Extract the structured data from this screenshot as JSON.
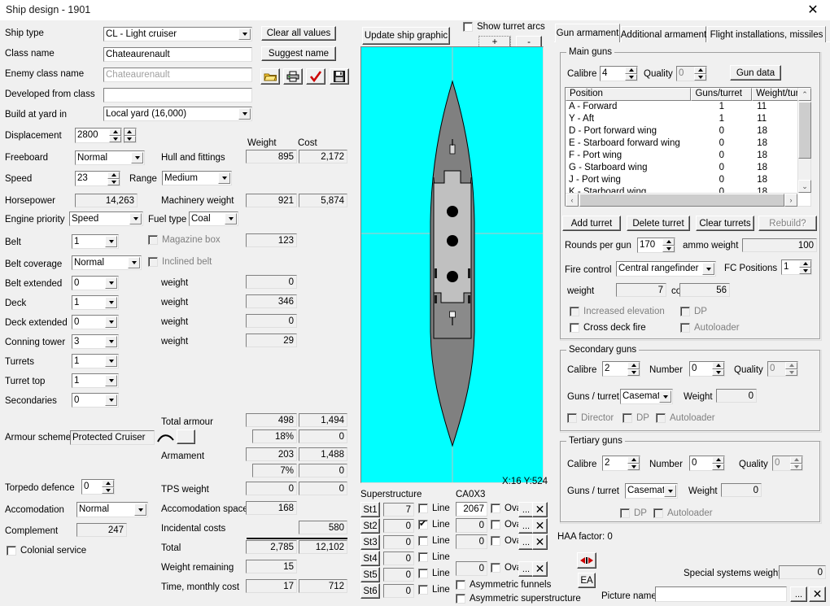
{
  "window": {
    "title": "Ship design - 1901",
    "close_icon": "close-icon"
  },
  "left_panel": {
    "fields": [
      {
        "label": "Ship type",
        "value": "CL - Light cruiser"
      },
      {
        "label": "Class name",
        "value": "Chateaurenault"
      },
      {
        "label": "Enemy class name",
        "value": "Chateaurenault"
      },
      {
        "label": "Developed from class",
        "value": ""
      },
      {
        "label": "Build at yard in",
        "value": "Local yard (16,000)"
      },
      {
        "label": "Displacement",
        "value": "2800"
      },
      {
        "label": "Freeboard",
        "value": "Normal"
      },
      {
        "label": "Speed",
        "value": "23"
      },
      {
        "label": "Range",
        "value": "Medium"
      },
      {
        "label": "Horsepower",
        "value": "14,263"
      },
      {
        "label": "Engine priority",
        "value": "Speed"
      },
      {
        "label": "Fuel type",
        "value": "Coal"
      },
      {
        "label": "Belt",
        "value": "1"
      },
      {
        "label": "Belt coverage",
        "value": "Normal"
      },
      {
        "label": "Belt extended",
        "value": "0"
      },
      {
        "label": "Deck",
        "value": "1"
      },
      {
        "label": "Deck extended",
        "value": "0"
      },
      {
        "label": "Conning tower",
        "value": "3"
      },
      {
        "label": "Turrets",
        "value": "1"
      },
      {
        "label": "Turret top",
        "value": "1"
      },
      {
        "label": "Secondaries",
        "value": "0"
      },
      {
        "label": "Armour scheme",
        "value": "Protected Cruiser"
      },
      {
        "label": "Torpedo defence",
        "value": "0"
      },
      {
        "label": "Accomodation",
        "value": "Normal"
      },
      {
        "label": "Complement",
        "value": "247"
      }
    ],
    "checkboxes": {
      "magazine_box": "Magazine box",
      "inclined_belt": "Inclined belt",
      "colonial_service": "Colonial service"
    },
    "weight_labels": {
      "hull_and_fittings": "Hull and fittings",
      "machinery_weight": "Machinery weight",
      "weight_1": "weight",
      "weight_2": "weight",
      "weight_3": "weight",
      "weight_4": "weight",
      "total_armour": "Total armour",
      "armament": "Armament",
      "tps_weight": "TPS weight",
      "accomodation_space": "Accomodation space",
      "incidental_costs": "Incidental costs",
      "total": "Total",
      "weight_remaining": "Weight remaining",
      "time_monthly_cost": "Time, monthly cost"
    },
    "columns": {
      "weight": "Weight",
      "cost": "Cost"
    },
    "values": {
      "hull_weight": "895",
      "hull_cost": "2,172",
      "machinery_weight": "921",
      "machinery_cost": "5,874",
      "belt_weight": "123",
      "w1": "0",
      "w2": "346",
      "w3": "0",
      "w4": "29",
      "total_armour_weight": "498",
      "total_armour_cost": "1,494",
      "armour_pct": "18%",
      "armour_pct_cost": "0",
      "armament_weight": "203",
      "armament_cost": "1,488",
      "armament_pct": "7%",
      "armament_pct_cost": "0",
      "tps_weight": "0",
      "tps_cost": "0",
      "accomodation_space": "168",
      "incidental_costs": "580",
      "total_weight": "2,785",
      "total_cost": "12,102",
      "weight_remaining": "15",
      "time": "17",
      "monthly_cost": "712"
    }
  },
  "toolbar": {
    "clear_all_values": "Clear all values",
    "suggest_name": "Suggest name",
    "open_icon": "open-folder-icon",
    "print_icon": "printer-icon",
    "check_icon": "check-mark-icon",
    "save_icon": "floppy-save-icon",
    "update_ship_graphic": "Update ship graphic",
    "show_turret_arcs": "Show turret arcs",
    "zoom_in": "+",
    "zoom_out": "-"
  },
  "ship_graphic": {
    "coordinates": "X:16 Y:524",
    "sea_color": "#00ffff",
    "hull_color": "#808080",
    "superstructure_color": "#c0c0c0"
  },
  "superstructure": {
    "title": "Superstructure",
    "funnel_title": "CA0X3",
    "rows": [
      {
        "name": "St1",
        "value": "7",
        "line": "Line",
        "line_checked": false
      },
      {
        "name": "St2",
        "value": "0",
        "line": "Line",
        "line_checked": true
      },
      {
        "name": "St3",
        "value": "0",
        "line": "Line",
        "line_checked": false
      },
      {
        "name": "St4",
        "value": "0",
        "line": "Line",
        "line_checked": false
      },
      {
        "name": "St5",
        "value": "0",
        "line": "Line",
        "line_checked": false
      },
      {
        "name": "St6",
        "value": "0",
        "line": "Line",
        "line_checked": false
      }
    ],
    "funnels": [
      {
        "value": "2067",
        "oval": "Oval",
        "oval_checked": false,
        "browse": "...",
        "clear": "✕"
      },
      {
        "value": "0",
        "oval": "Oval",
        "oval_checked": false,
        "browse": "...",
        "clear": "✕"
      },
      {
        "value": "0",
        "oval": "Oval",
        "oval_checked": false,
        "browse": "...",
        "clear": "✕"
      },
      {
        "value": "0",
        "oval": "Oval",
        "oval_checked": false,
        "browse": "...",
        "clear": "✕"
      }
    ],
    "asymmetric_funnels": "Asymmetric funnels",
    "asymmetric_superstructure": "Asymmetric superstructure"
  },
  "right_panel": {
    "tabs": [
      {
        "label": "Gun armament",
        "active": true
      },
      {
        "label": "Additional armament",
        "active": false
      },
      {
        "label": "Flight installations, missiles",
        "active": false
      }
    ],
    "main_guns": {
      "title": "Main guns",
      "calibre_label": "Calibre",
      "calibre": "4",
      "quality_label": "Quality",
      "quality": "0",
      "gun_data_button": "Gun data",
      "columns": [
        "Position",
        "Guns/turret",
        "Weight/turret"
      ],
      "rows": [
        {
          "position": "A - Forward",
          "guns": "1",
          "weight": "11"
        },
        {
          "position": "Y - Aft",
          "guns": "1",
          "weight": "11"
        },
        {
          "position": "D - Port forward wing",
          "guns": "0",
          "weight": "18"
        },
        {
          "position": "E - Starboard forward wing",
          "guns": "0",
          "weight": "18"
        },
        {
          "position": "F - Port wing",
          "guns": "0",
          "weight": "18"
        },
        {
          "position": "G - Starboard wing",
          "guns": "0",
          "weight": "18"
        },
        {
          "position": "J - Port wing",
          "guns": "0",
          "weight": "18"
        },
        {
          "position": "K - Starboard wing",
          "guns": "0",
          "weight": "18"
        }
      ],
      "add_turret": "Add turret",
      "delete_turret": "Delete turret",
      "clear_turrets": "Clear turrets",
      "rebuild": "Rebuild?",
      "rounds_per_gun_label": "Rounds per gun",
      "rounds_per_gun": "170",
      "ammo_weight_label": "ammo weight",
      "ammo_weight": "100",
      "fire_control_label": "Fire control",
      "fire_control": "Central rangefinder",
      "fc_positions_label": "FC Positions",
      "fc_positions": "1",
      "weight_label": "weight",
      "weight": "7",
      "cost_label": "cost",
      "cost": "56",
      "increased_elevation": "Increased elevation",
      "dp": "DP",
      "cross_deck_fire": "Cross deck fire",
      "autoloader": "Autoloader"
    },
    "secondary_guns": {
      "title": "Secondary guns",
      "calibre_label": "Calibre",
      "calibre": "2",
      "number_label": "Number",
      "number": "0",
      "quality_label": "Quality",
      "quality": "0",
      "guns_per_turret_label": "Guns / turret",
      "guns_per_turret": "Casemate:",
      "weight_label": "Weight",
      "weight": "0",
      "director": "Director",
      "dp": "DP",
      "autoloader": "Autoloader"
    },
    "tertiary_guns": {
      "title": "Tertiary guns",
      "calibre_label": "Calibre",
      "calibre": "2",
      "number_label": "Number",
      "number": "0",
      "quality_label": "Quality",
      "quality": "0",
      "guns_per_turret_label": "Guns / turret",
      "guns_per_turret": "Casemate:",
      "weight_label": "Weight",
      "weight": "0",
      "dp": "DP",
      "autoloader": "Autoloader"
    },
    "haa_factor": "HAA factor: 0",
    "special_systems_weight_label": "Special systems weight",
    "special_systems_weight": "0",
    "picture_name_label": "Picture name",
    "picture_name": "",
    "picture_browse": "...",
    "picture_clear": "✕",
    "nav_icon": "left-right-arrows-icon",
    "ea_button": "EA"
  }
}
